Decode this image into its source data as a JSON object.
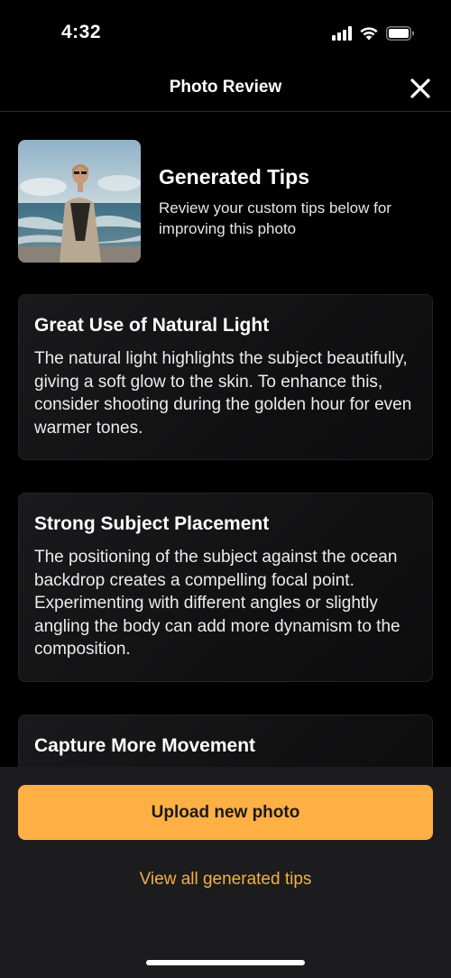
{
  "status_bar": {
    "time": "4:32"
  },
  "nav": {
    "title": "Photo Review"
  },
  "header": {
    "title": "Generated Tips",
    "subtitle": "Review your custom tips below for improving this photo"
  },
  "tips": [
    {
      "title": "Great Use of Natural Light",
      "body": "The natural light highlights the subject beautifully, giving a soft glow to the skin. To enhance this, consider shooting during the golden hour for even warmer tones."
    },
    {
      "title": "Strong Subject Placement",
      "body": "The positioning of the subject against the ocean backdrop creates a compelling focal point. Experimenting with different angles or slightly angling the body can add more dynamism to the composition."
    },
    {
      "title": "Capture More Movement",
      "body": ""
    }
  ],
  "actions": {
    "upload_label": "Upload new photo",
    "view_all_label": "View all generated tips"
  },
  "colors": {
    "accent": "#ffb044",
    "link": "#f5ad45",
    "background": "#000000",
    "panel": "#1c1c1e"
  },
  "icons": {
    "close": "close-icon",
    "signal": "cellular-signal-icon",
    "wifi": "wifi-icon",
    "battery": "battery-icon"
  }
}
